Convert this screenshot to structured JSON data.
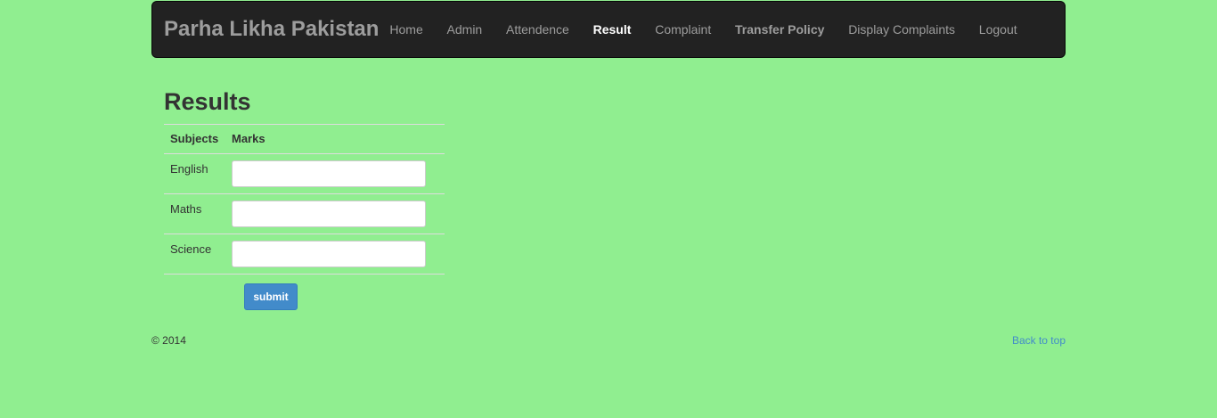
{
  "navbar": {
    "brand": "Parha Likha Pakistan",
    "items": [
      {
        "label": "Home"
      },
      {
        "label": "Admin"
      },
      {
        "label": "Attendence"
      },
      {
        "label": "Result"
      },
      {
        "label": "Complaint"
      },
      {
        "label": "Transfer Policy"
      },
      {
        "label": "Display Complaints"
      },
      {
        "label": "Logout"
      }
    ],
    "active": "Result"
  },
  "main": {
    "title": "Results",
    "table": {
      "headers": [
        "Subjects",
        "Marks"
      ],
      "rows": [
        {
          "subject": "English",
          "marks": ""
        },
        {
          "subject": "Maths",
          "marks": ""
        },
        {
          "subject": "Science",
          "marks": ""
        }
      ]
    },
    "submit_label": "submit"
  },
  "footer": {
    "copyright": "© 2014",
    "back_to_top": "Back to top"
  },
  "colors": {
    "background": "#90ee90",
    "navbar": "#222222",
    "primary_button": "#428bca",
    "link": "#428bca"
  }
}
